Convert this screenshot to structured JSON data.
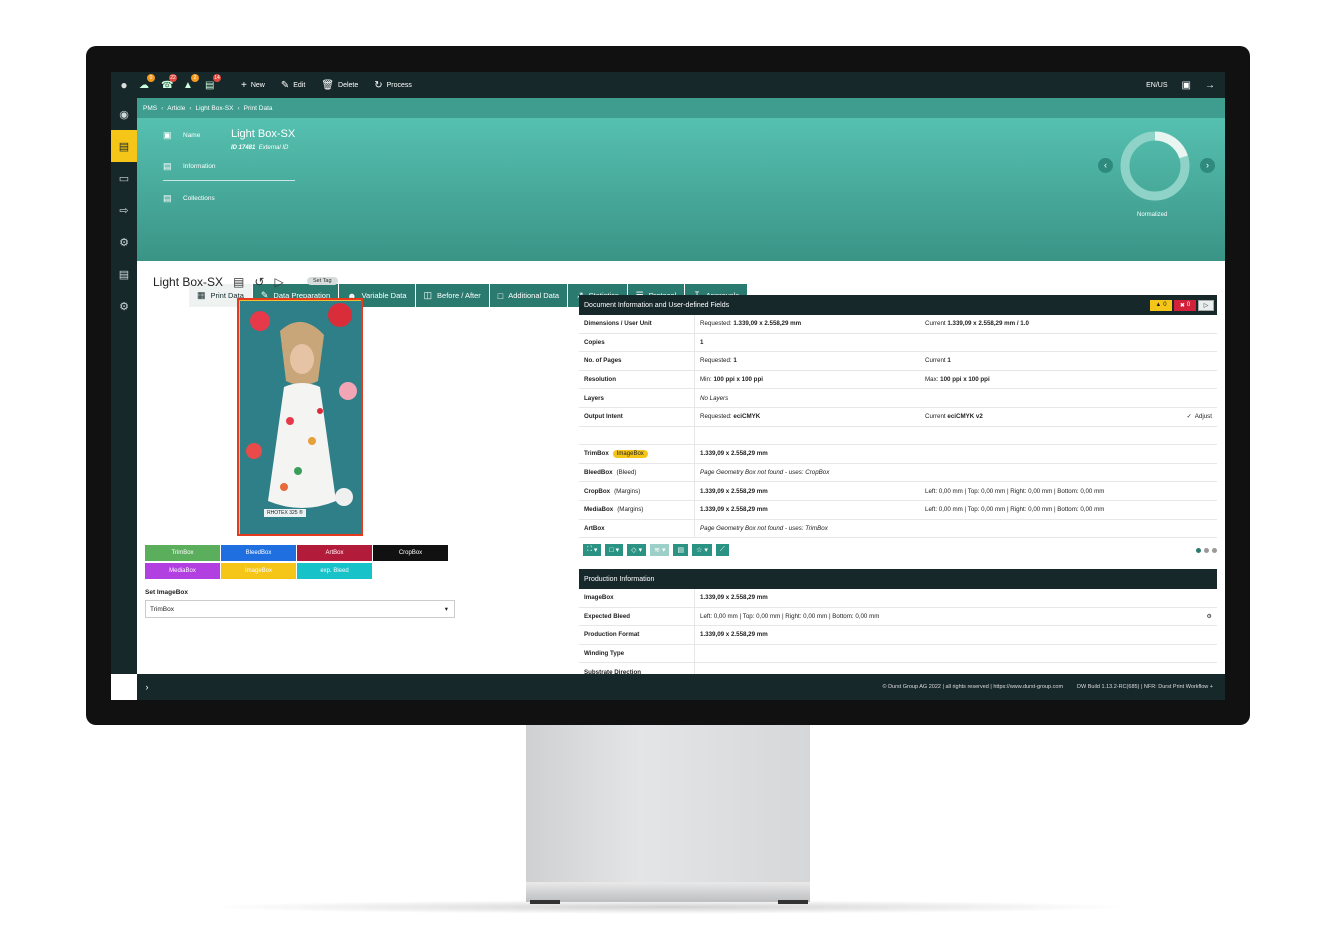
{
  "topbar": {
    "notifications": [
      {
        "icon": "cloud-icon",
        "count": "0",
        "color": "#f59a1f"
      },
      {
        "icon": "headset-icon",
        "count": "22",
        "color": "#e2483d"
      },
      {
        "icon": "cart-icon",
        "count": "2",
        "color": "#f59a1f"
      },
      {
        "icon": "printer-icon",
        "count": "14",
        "color": "#e2483d"
      }
    ],
    "actions": {
      "new": "New",
      "edit": "Edit",
      "delete": "Delete",
      "process": "Process"
    },
    "locale": "EN/US"
  },
  "breadcrumb": [
    "PMS",
    "Article",
    "Light Box-SX",
    "Print Data"
  ],
  "hero": {
    "name_label": "Name",
    "name_value": "Light Box-SX",
    "id_text": "ID 17481",
    "external_id": "External ID",
    "information_label": "Information",
    "collections_label": "Collections",
    "status_label": "Normalized",
    "progress": 0.2
  },
  "tabs": [
    {
      "label": "Print Data",
      "icon": "scan-icon",
      "active": true
    },
    {
      "label": "Data Preparation",
      "icon": "edit-icon",
      "active": false
    },
    {
      "label": "Variable Data",
      "icon": "user-icon",
      "active": false
    },
    {
      "label": "Before / After",
      "icon": "compare-icon",
      "active": false
    },
    {
      "label": "Additional Data",
      "icon": "file-icon",
      "active": false
    },
    {
      "label": "Statistics",
      "icon": "chart-icon",
      "active": false
    },
    {
      "label": "Protocol",
      "icon": "list-icon",
      "active": false
    },
    {
      "label": "Approvals",
      "icon": "download-icon",
      "active": false
    }
  ],
  "article": {
    "title": "Light Box-SX",
    "set_tag": "Set Tag",
    "preview_label": "RHOTEX 325 ®"
  },
  "box_buttons": [
    {
      "label": "TrimBox",
      "color": "#5aae5c"
    },
    {
      "label": "BleedBox",
      "color": "#1f6fe0"
    },
    {
      "label": "ArtBox",
      "color": "#b31b3b"
    },
    {
      "label": "CropBox",
      "color": "#111111"
    },
    {
      "label": "MediaBox",
      "color": "#b23fe0"
    },
    {
      "label": "ImageBox",
      "color": "#f5c518"
    },
    {
      "label": "exp. Bleed",
      "color": "#17c2c9"
    }
  ],
  "set_imagebox": {
    "label": "Set ImageBox",
    "value": "TrimBox"
  },
  "doc_panel": {
    "title": "Document Information and User-defined Fields",
    "warnings": "0",
    "errors": "0",
    "rows": [
      {
        "key": "Dimensions / User Unit",
        "v1_label": "Requested:",
        "v1": "1.339,09 x 2.558,29 mm",
        "v2_label": "Current",
        "v2": "1.339,09 x 2.558,29 mm / 1.0"
      },
      {
        "key": "Copies",
        "v1_label": "",
        "v1": "1",
        "v2_label": "",
        "v2": ""
      },
      {
        "key": "No. of Pages",
        "v1_label": "Requested:",
        "v1": "1",
        "v2_label": "Current",
        "v2": "1"
      },
      {
        "key": "Resolution",
        "v1_label": "Min:",
        "v1": "100 ppi x 100 ppi",
        "v2_label": "Max:",
        "v2": "100 ppi x 100 ppi"
      },
      {
        "key": "Layers",
        "v1_label": "",
        "v1": "No Layers",
        "v2_label": "",
        "v2": ""
      },
      {
        "key": "Output Intent",
        "v1_label": "Requested:",
        "v1": "eciCMYK",
        "v2_label": "Current",
        "v2": "eciCMYK v2"
      }
    ],
    "adjust_label": "Adjust",
    "box_rows": [
      {
        "key": "TrimBox",
        "badge": "ImageBox",
        "value": "1.339,09 x 2.558,29 mm",
        "margins": ""
      },
      {
        "key": "BleedBox",
        "note": "(Bleed)",
        "value": "Page Geometry Box not found - uses: CropBox",
        "margins": ""
      },
      {
        "key": "CropBox",
        "note": "(Margins)",
        "value": "1.339,09 x 2.558,29 mm",
        "margins": "Left: 0,00 mm | Top: 0,00 mm | Right: 0,00 mm | Bottom: 0,00 mm"
      },
      {
        "key": "MediaBox",
        "note": "(Margins)",
        "value": "1.339,09 x 2.558,29 mm",
        "margins": "Left: 0,00 mm | Top: 0,00 mm | Right: 0,00 mm | Bottom: 0,00 mm"
      },
      {
        "key": "ArtBox",
        "note": "",
        "value": "Page Geometry Box not found - uses: TrimBox",
        "margins": ""
      }
    ]
  },
  "prod_panel": {
    "title": "Production Information",
    "rows": [
      {
        "key": "ImageBox",
        "value": "1.339,09 x 2.558,29 mm"
      },
      {
        "key": "Expected Bleed",
        "value": "Left: 0,00 mm | Top: 0,00 mm | Right: 0,00 mm | Bottom: 0,00 mm"
      },
      {
        "key": "Production Format",
        "value": "1.339,09 x 2.558,29 mm"
      },
      {
        "key": "Winding Type",
        "value": ""
      },
      {
        "key": "Substrate Direction",
        "value": ""
      }
    ]
  },
  "footer": {
    "copyright": "© Durst Group AG 2022 | all rights reserved | https://www.durst-group.com",
    "build": "DW Build 1.13.2-RC(685)  |  NFR: Durst Print Workflow +"
  }
}
